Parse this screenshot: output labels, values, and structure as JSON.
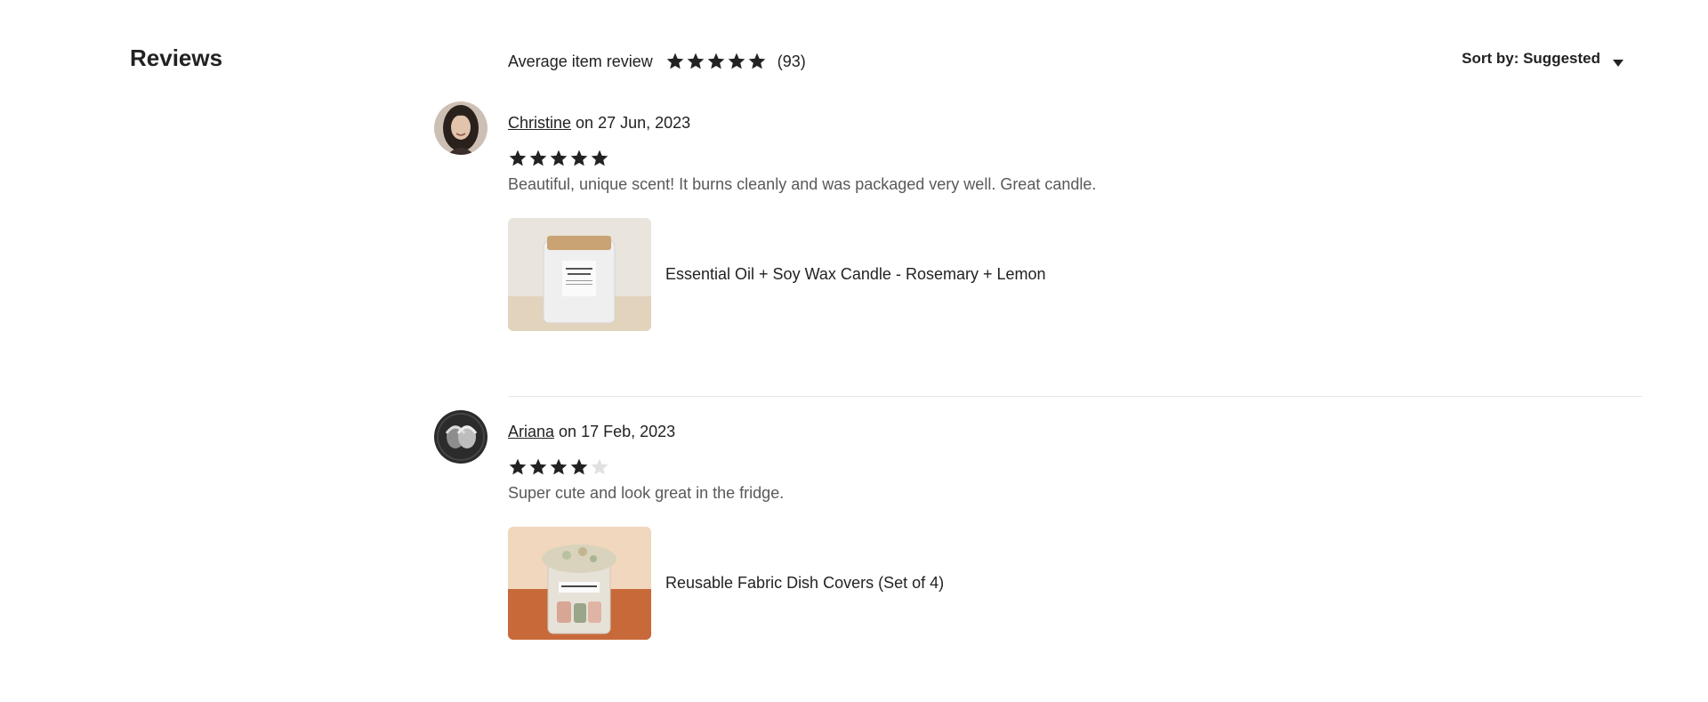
{
  "section": {
    "title": "Reviews"
  },
  "summary": {
    "label": "Average item review",
    "rating": 5,
    "max_rating": 5,
    "count": "(93)",
    "star_icon": "star-icon"
  },
  "sort": {
    "label": "Sort by: Suggested",
    "icon": "caret-down-icon"
  },
  "colors": {
    "star_filled": "#222222",
    "star_empty": "#e1e1e1",
    "divider": "#e6e6e6",
    "text_primary": "#222222",
    "text_secondary": "#595959"
  },
  "reviews": [
    {
      "author": "Christine",
      "date_text": "on 27 Jun, 2023",
      "rating": 5,
      "max_rating": 5,
      "text": "Beautiful, unique scent! It burns cleanly and was packaged very well. Great candle.",
      "product": {
        "name": "Essential Oil + Soy Wax Candle - Rosemary + Lemon",
        "image": "candle-jar-image"
      }
    },
    {
      "author": "Ariana",
      "date_text": "on 17 Feb, 2023",
      "rating": 4,
      "max_rating": 5,
      "text": "Super cute and look great in the fridge.",
      "product": {
        "name": "Reusable Fabric Dish Covers (Set of 4)",
        "image": "dish-covers-jar-image"
      }
    }
  ]
}
